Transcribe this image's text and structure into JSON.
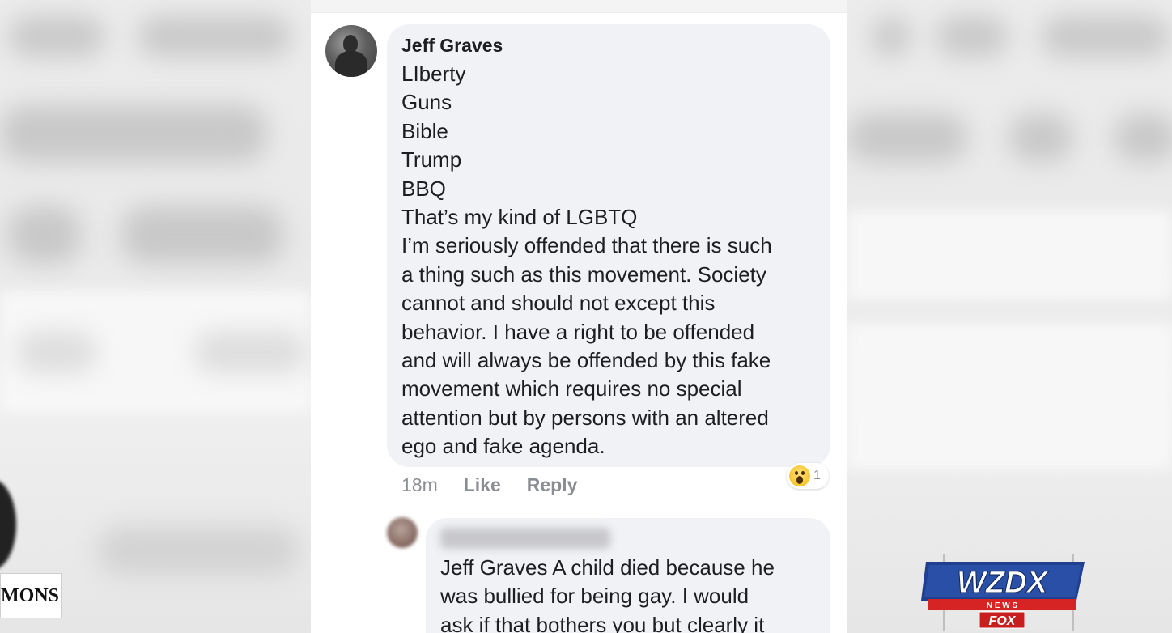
{
  "comment": {
    "author": "Jeff Graves",
    "lines": [
      "LIberty",
      "Guns",
      "Bible",
      "Trump",
      "BBQ",
      "That’s my kind of LGBTQ",
      "I’m seriously offended that there is such",
      "a thing such as this movement.  Society",
      "cannot and should not except this",
      "behavior.   I have a right to be offended",
      "and will always be offended by this fake",
      "movement which requires no special",
      "attention but by persons with an altered",
      "ego and fake agenda."
    ],
    "time": "18m",
    "like_label": "Like",
    "reply_label": "Reply",
    "reaction_icon": "wow-emoji-icon",
    "reaction_count": "1"
  },
  "reply": {
    "lines": [
      "Jeff Graves A child died because he",
      "was bullied for being gay. I would",
      "ask if that bothers you but clearly it"
    ]
  },
  "lower_third": {
    "name_fragment": "MONS"
  },
  "logo": {
    "text": "WZDX",
    "subtext": "N E W S",
    "network": "FOX",
    "colors": {
      "blue": "#1f3f8f",
      "red": "#d62424",
      "silver": "#d9d9d9"
    }
  }
}
